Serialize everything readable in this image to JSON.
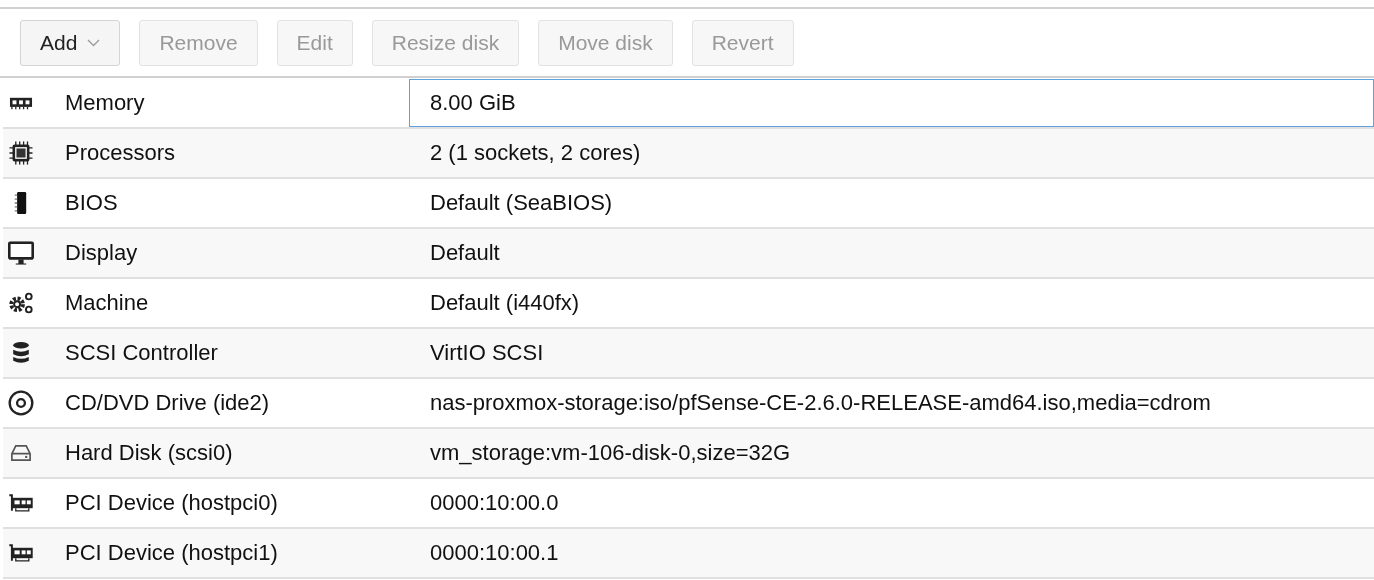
{
  "toolbar": {
    "buttons": [
      {
        "label": "Add",
        "disabled": false,
        "menu": true
      },
      {
        "label": "Remove",
        "disabled": true,
        "menu": false
      },
      {
        "label": "Edit",
        "disabled": true,
        "menu": false
      },
      {
        "label": "Resize disk",
        "disabled": true,
        "menu": false
      },
      {
        "label": "Move disk",
        "disabled": true,
        "menu": false
      },
      {
        "label": "Revert",
        "disabled": true,
        "menu": false
      }
    ]
  },
  "rows": [
    {
      "kind": "memory",
      "name": "Memory",
      "value": "8.00 GiB",
      "focused": true
    },
    {
      "kind": "cpu",
      "name": "Processors",
      "value": "2 (1 sockets, 2 cores)",
      "focused": false
    },
    {
      "kind": "bios",
      "name": "BIOS",
      "value": "Default (SeaBIOS)",
      "focused": false
    },
    {
      "kind": "display",
      "name": "Display",
      "value": "Default",
      "focused": false
    },
    {
      "kind": "machine",
      "name": "Machine",
      "value": "Default (i440fx)",
      "focused": false
    },
    {
      "kind": "scsi",
      "name": "SCSI Controller",
      "value": "VirtIO SCSI",
      "focused": false
    },
    {
      "kind": "cdrom",
      "name": "CD/DVD Drive (ide2)",
      "value": "nas-proxmox-storage:iso/pfSense-CE-2.6.0-RELEASE-amd64.iso,media=cdrom",
      "focused": false
    },
    {
      "kind": "disk",
      "name": "Hard Disk (scsi0)",
      "value": "vm_storage:vm-106-disk-0,size=32G",
      "focused": false
    },
    {
      "kind": "pci",
      "name": "PCI Device (hostpci0)",
      "value": "0000:10:00.0",
      "focused": false
    },
    {
      "kind": "pci",
      "name": "PCI Device (hostpci1)",
      "value": "0000:10:00.1",
      "focused": false
    }
  ]
}
